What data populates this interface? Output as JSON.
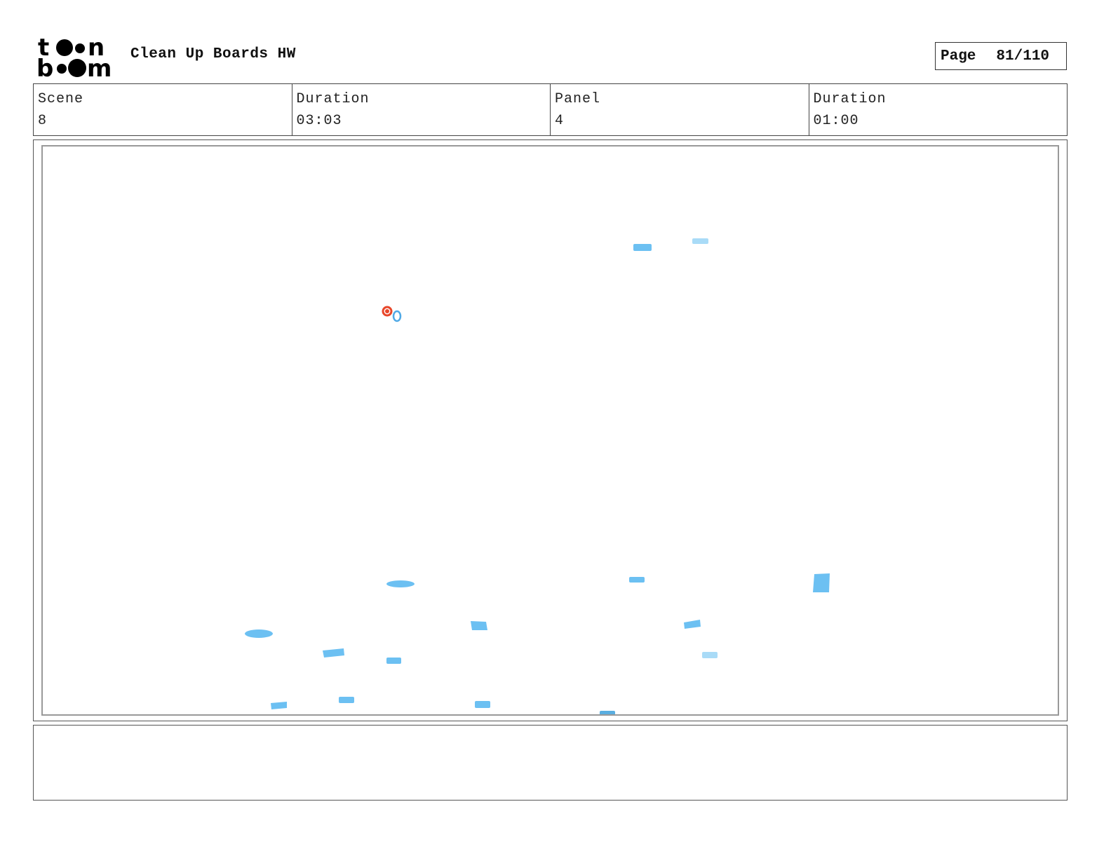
{
  "header": {
    "logo_text": "toon boom",
    "title": "Clean Up Boards HW",
    "page_label": "Page",
    "page_number": "81/110"
  },
  "info": {
    "scene_label": "Scene",
    "scene_value": "8",
    "scene_duration_label": "Duration",
    "scene_duration_value": "03:03",
    "panel_label": "Panel",
    "panel_value": "4",
    "panel_duration_label": "Duration",
    "panel_duration_value": "01:00"
  },
  "drawing": {
    "mark_color": "#6cc0f2",
    "mark_color_light": "#a9dbf7",
    "accent_color": "#e8472a"
  },
  "notes": {
    "text": ""
  }
}
